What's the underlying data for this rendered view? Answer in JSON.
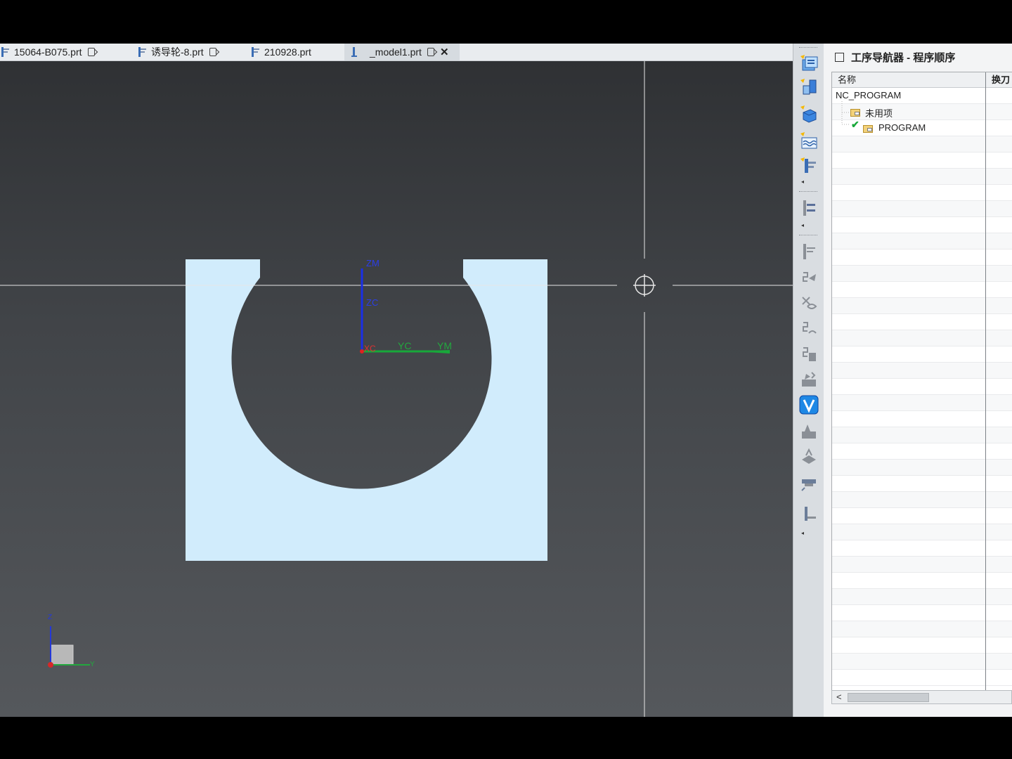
{
  "tabs": [
    {
      "label": "15064-B075.prt",
      "active": false
    },
    {
      "label": "诱导轮-8.prt",
      "active": false
    },
    {
      "label": "210928.prt",
      "active": false
    },
    {
      "label": "_model1.prt",
      "active": true
    }
  ],
  "viewport": {
    "wcs_labels": {
      "zm": "ZM",
      "zc": "ZC",
      "xc": "XC",
      "yc": "YC",
      "ym": "YM"
    },
    "triad": {
      "z": "Z",
      "y": "Y"
    },
    "part_color": "#d1ecfc",
    "bg_top": "#2f3134",
    "bg_bottom": "#55585c"
  },
  "toolbar": {
    "icons": [
      "create-program-icon",
      "create-tool-icon",
      "create-geometry-icon",
      "create-method-icon",
      "create-operation-icon",
      "program-order-icon",
      "machine-tool-view-icon",
      "generate-path-icon",
      "replay-path-icon",
      "list-path-icon",
      "verify-path-icon",
      "postprocess-icon",
      "vericut-icon",
      "shop-doc-icon",
      "output-cldata-icon",
      "tool-holder-icon",
      "tool-path-edit-icon"
    ]
  },
  "navigator": {
    "title": "工序导航器 - 程序顺序",
    "columns": [
      "名称",
      "换刀"
    ],
    "root": "NC_PROGRAM",
    "items": [
      {
        "label": "未用项",
        "checked": false
      },
      {
        "label": "PROGRAM",
        "checked": true
      }
    ],
    "scroll_left": "<"
  }
}
